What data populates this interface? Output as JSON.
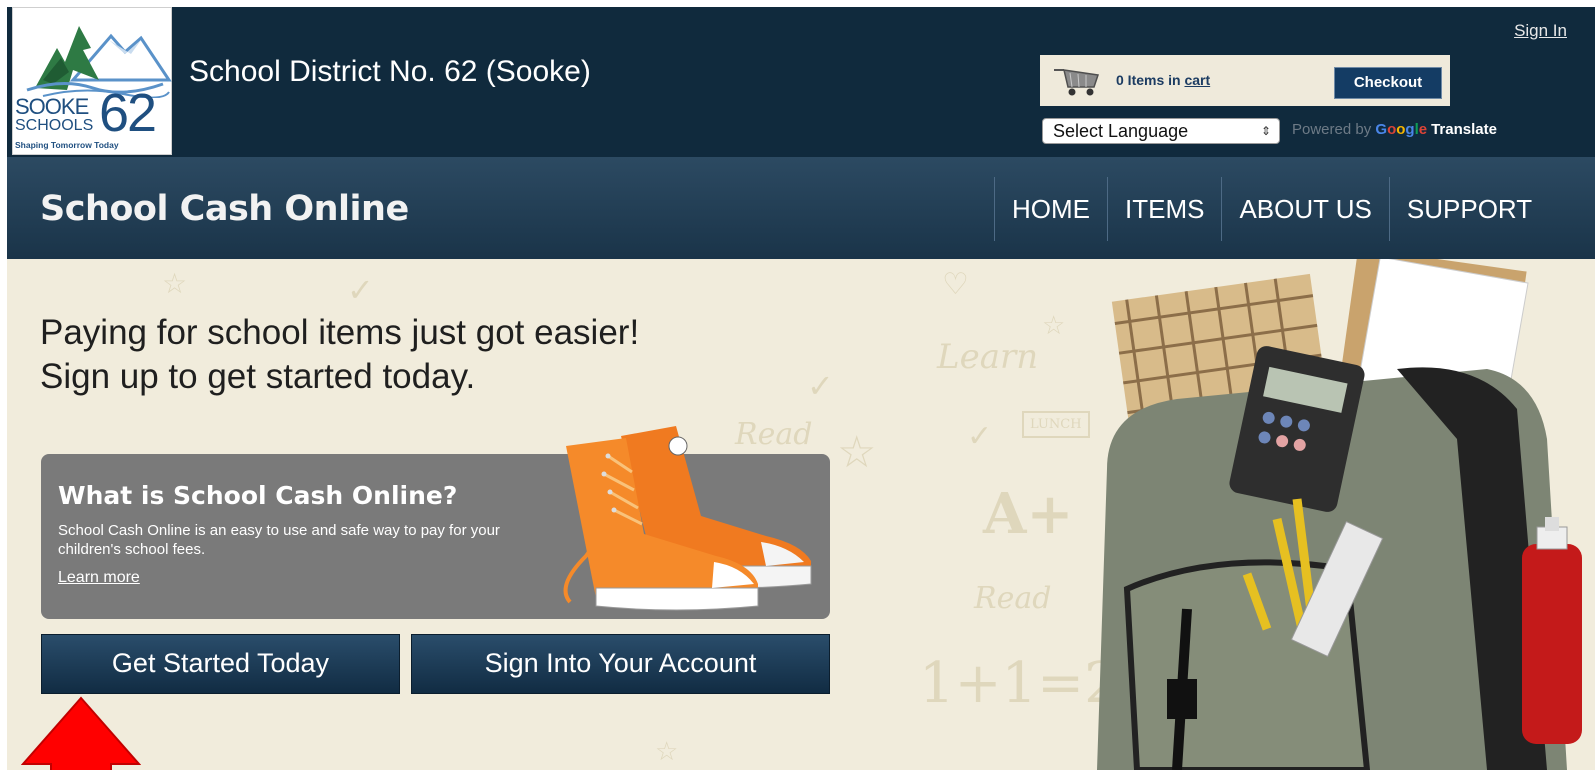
{
  "header": {
    "logo": {
      "word1": "SOOKE",
      "word2": "SCHOOLS",
      "number": "62",
      "tagline": "Shaping Tomorrow Today"
    },
    "district_name": "School District No. 62 (Sooke)",
    "sign_in": "Sign In",
    "cart": {
      "count_text": "0 Items in",
      "link_text": "cart",
      "checkout_label": "Checkout"
    },
    "language": {
      "selected": "Select Language"
    },
    "powered_by": {
      "prefix": "Powered by",
      "google": "Google",
      "translate": "Translate"
    }
  },
  "nav": {
    "brand": "School Cash Online",
    "items": [
      {
        "label": "HOME"
      },
      {
        "label": "ITEMS"
      },
      {
        "label": "ABOUT US"
      },
      {
        "label": "SUPPORT"
      }
    ]
  },
  "hero": {
    "headline_line1": "Paying for school items just got easier!",
    "headline_line2": "Sign up to get started today.",
    "info": {
      "title": "What is School Cash Online?",
      "description": "School Cash Online is an easy to use and safe way to pay for your children's school fees.",
      "learn_more": "Learn more"
    },
    "buttons": {
      "get_started": "Get Started Today",
      "sign_into": "Sign Into Your Account"
    },
    "doodles": [
      "Learn",
      "Read",
      "A+",
      "Read",
      "1+1=2",
      "LUNCH"
    ]
  },
  "colors": {
    "header_bg": "#102a3d",
    "nav_bg": "#1f3a50",
    "hero_bg": "#f1ecdc",
    "button_bg": "#1b3a56",
    "info_box_bg": "#7a7a7a",
    "annotation_arrow": "#ff0000"
  },
  "icons": {
    "cart": "shopping-cart-icon",
    "select_arrows": "select-arrows-icon",
    "annotation": "red-arrow-icon"
  }
}
